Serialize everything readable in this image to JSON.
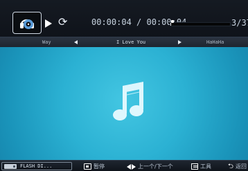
{
  "player": {
    "elapsed": "00:00:04",
    "separator": "/",
    "total": "00:00:04",
    "track_count": "3/37",
    "progress_fraction": 0.01
  },
  "nav": {
    "prev_name": "Way",
    "current_title": "I Love You",
    "next_name": "HaHaHa"
  },
  "storage": {
    "label": "FLASH DI..."
  },
  "hints": {
    "pause": "暂停",
    "prev_next": "上一个/下一个",
    "tools": "工具",
    "back": "返回"
  },
  "colors": {
    "content_bg": "#2bb1d3",
    "icon_fill": "#d9f4fb"
  },
  "icons": {
    "device": "headphones-disc-icon",
    "play": "play-icon",
    "repeat": "repeat-icon",
    "music": "music-note-icon"
  }
}
